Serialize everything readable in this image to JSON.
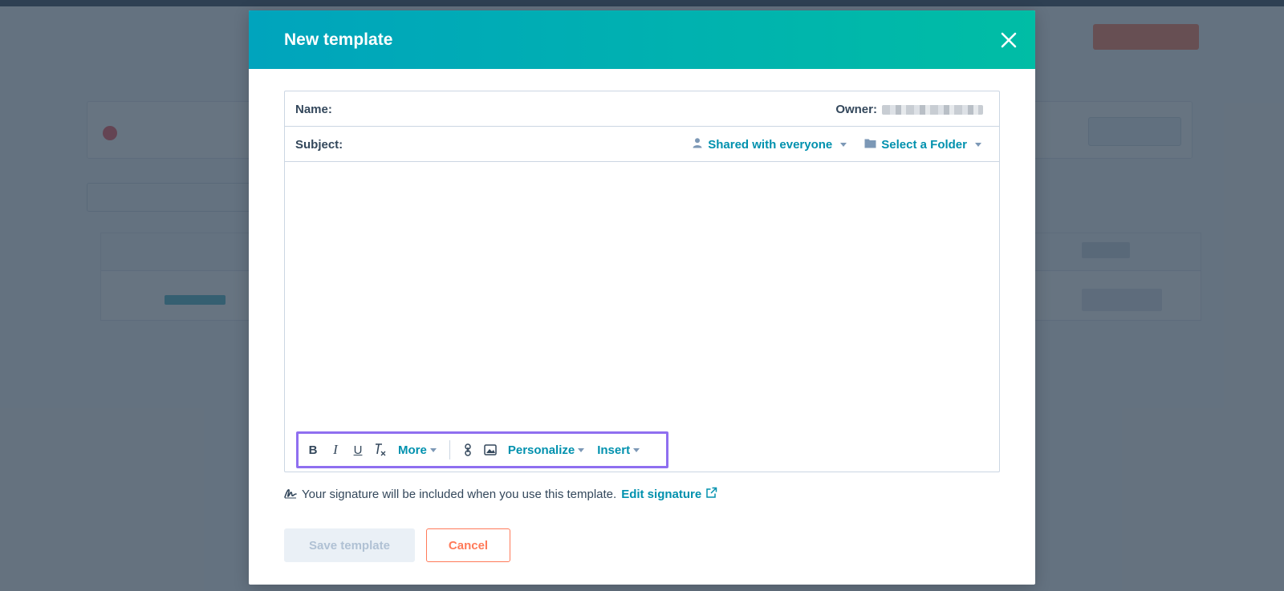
{
  "modal": {
    "title": "New template",
    "fields": {
      "name_label": "Name:",
      "owner_label": "Owner:",
      "subject_label": "Subject:"
    },
    "sharing": {
      "label": "Shared with everyone"
    },
    "folder": {
      "label": "Select a Folder"
    },
    "toolbar": {
      "bold": "B",
      "italic": "I",
      "underline": "U",
      "clear_format": "Tx",
      "more_label": "More",
      "personalize_label": "Personalize",
      "insert_label": "Insert"
    },
    "signature": {
      "text": "Your signature will be included when you use this template.",
      "link": "Edit signature"
    },
    "buttons": {
      "save": "Save template",
      "cancel": "Cancel"
    }
  },
  "colors": {
    "header_gradient_start": "#00a4bd",
    "header_gradient_end": "#00bda5",
    "link": "#0091ae",
    "cancel": "#ff7a59",
    "toolbar_highlight": "#8f6ff0"
  }
}
